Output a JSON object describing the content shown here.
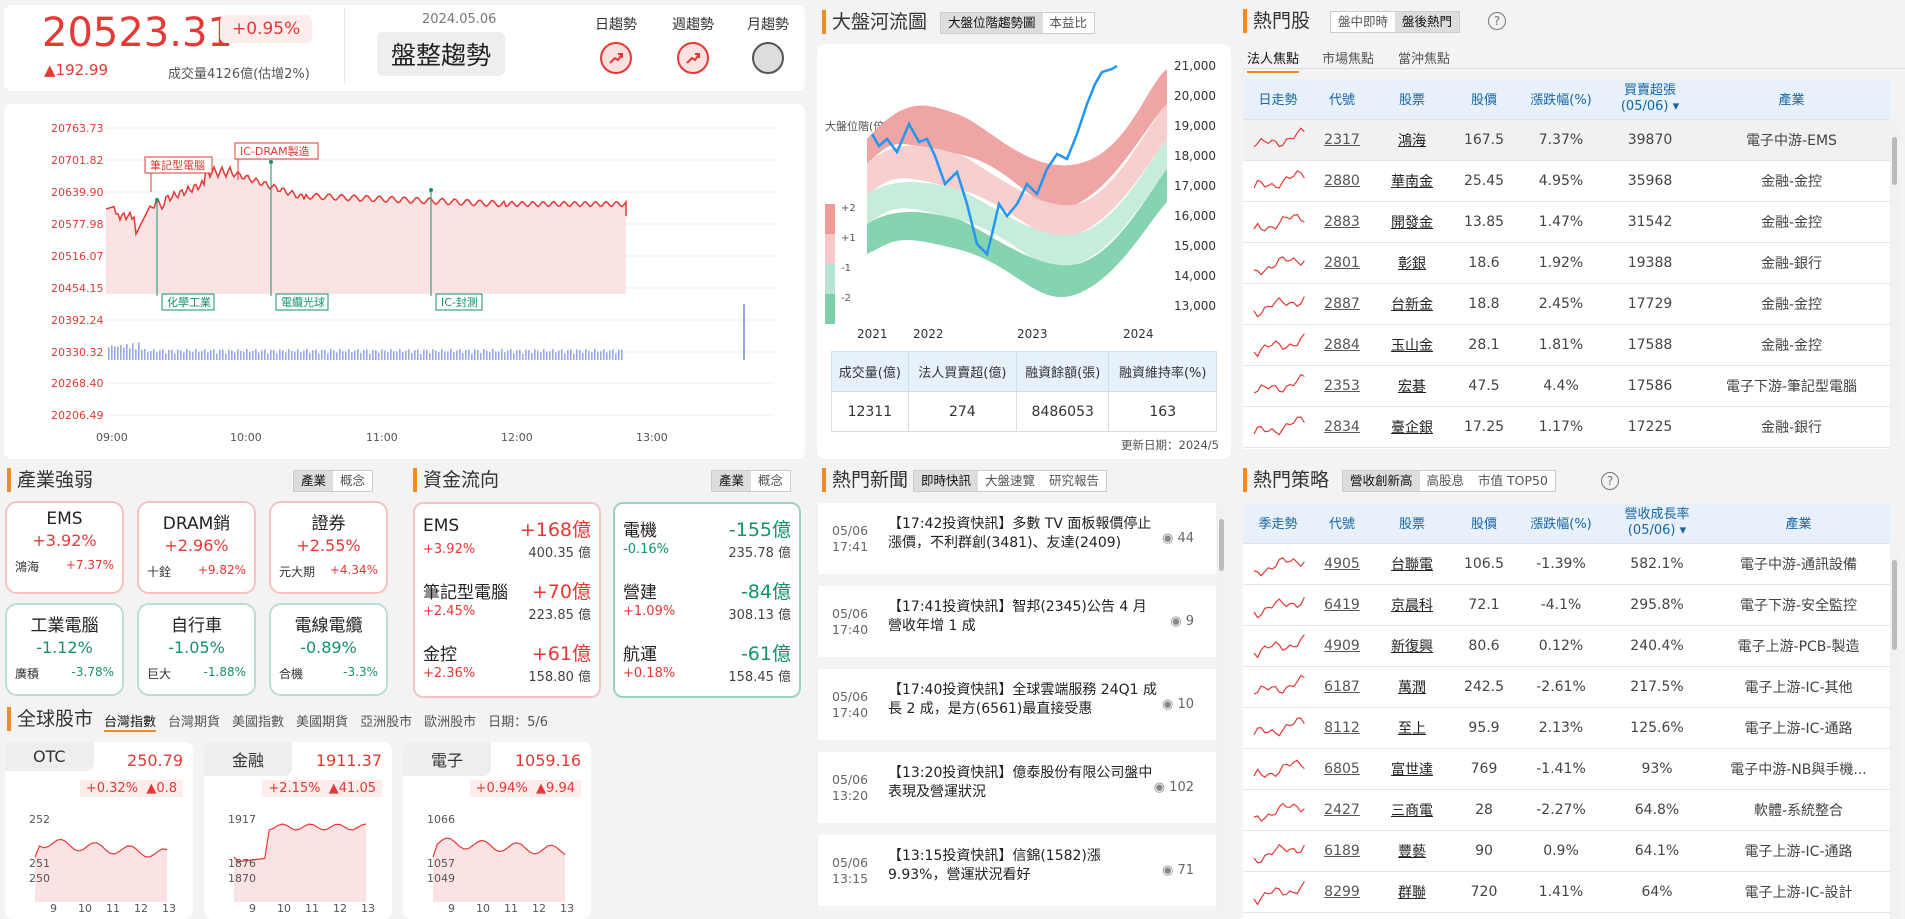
{
  "quote": {
    "last": "20523.31",
    "pct": "+0.95%",
    "chg": "▲192.99",
    "vol": "成交量4126億(估增2%)",
    "date": "2024.05.06",
    "trend": "盤整趨勢",
    "trends": [
      {
        "label": "日趨勢"
      },
      {
        "label": "週趨勢"
      },
      {
        "label": "月趨勢"
      }
    ]
  },
  "intraday": {
    "ylabels": [
      "20763.73",
      "20701.82",
      "20639.90",
      "20577.98",
      "20516.07",
      "20454.15",
      "20392.24",
      "20330.32"
    ],
    "vlabels": [
      "20268.40",
      "20206.49"
    ],
    "xlabels": [
      "09:00",
      "10:00",
      "11:00",
      "12:00",
      "13:00"
    ],
    "events_top": [
      "筆記型電腦",
      "IC-DRAM製造"
    ],
    "events_bottom": [
      "化學工業",
      "電纜光球",
      "IC-封測"
    ]
  },
  "river": {
    "title": "大盤河流圖",
    "tabs": [
      "大盤位階趨勢圖",
      "本益比"
    ],
    "ylabel": "大盤位階(倍)",
    "yticks": [
      "21,000",
      "20,000",
      "19,000",
      "18,000",
      "17,000",
      "16,000",
      "15,000",
      "14,000",
      "13,000"
    ],
    "xticks": [
      "2021",
      "2022",
      "2023",
      "2024"
    ],
    "bands": [
      "+2",
      "+1",
      "-1",
      "-2"
    ],
    "stats_head": [
      "成交量(億)",
      "法人買賣超(億)",
      "融資餘額(張)",
      "融資維持率(%)"
    ],
    "stats": [
      "12311",
      "274",
      "8486053",
      "163"
    ],
    "updated": "更新日期：2024/5"
  },
  "hot": {
    "title": "熱門股",
    "tabs": [
      "盤中即時",
      "盤後熱門"
    ],
    "subtabs": [
      "法人焦點",
      "市場焦點",
      "當沖焦點"
    ],
    "head": [
      "日走勢",
      "代號",
      "股票",
      "股價",
      "漲跌幅(%)",
      "買賣超張(05/06)",
      "產業"
    ],
    "rows": [
      {
        "code": "2317",
        "name": "鴻海",
        "price": "167.5",
        "pct": "7.37%",
        "net": "39870",
        "ind": "電子中游-EMS"
      },
      {
        "code": "2880",
        "name": "華南金",
        "price": "25.45",
        "pct": "4.95%",
        "net": "35968",
        "ind": "金融-金控"
      },
      {
        "code": "2883",
        "name": "開發金",
        "price": "13.85",
        "pct": "1.47%",
        "net": "31542",
        "ind": "金融-金控"
      },
      {
        "code": "2801",
        "name": "彰銀",
        "price": "18.6",
        "pct": "1.92%",
        "net": "19388",
        "ind": "金融-銀行"
      },
      {
        "code": "2887",
        "name": "台新金",
        "price": "18.8",
        "pct": "2.45%",
        "net": "17729",
        "ind": "金融-金控"
      },
      {
        "code": "2884",
        "name": "玉山金",
        "price": "28.1",
        "pct": "1.81%",
        "net": "17588",
        "ind": "金融-金控"
      },
      {
        "code": "2353",
        "name": "宏碁",
        "price": "47.5",
        "pct": "4.4%",
        "net": "17586",
        "ind": "電子下游-筆記型電腦"
      },
      {
        "code": "2834",
        "name": "臺企銀",
        "price": "17.25",
        "pct": "1.17%",
        "net": "17225",
        "ind": "金融-銀行"
      }
    ]
  },
  "industry": {
    "title": "產業強弱",
    "tabs": [
      "產業",
      "概念"
    ],
    "cards": [
      {
        "name": "EMS",
        "pct": "+3.92%",
        "stock": "鴻海",
        "spct": "+7.37%"
      },
      {
        "name": "DRAM銷",
        "pct": "+2.96%",
        "stock": "十銓",
        "spct": "+9.82%"
      },
      {
        "name": "證券",
        "pct": "+2.55%",
        "stock": "元大期",
        "spct": "+4.34%"
      },
      {
        "name": "工業電腦",
        "pct": "-1.12%",
        "stock": "廣積",
        "spct": "-3.78%"
      },
      {
        "name": "自行車",
        "pct": "-1.05%",
        "stock": "巨大",
        "spct": "-1.88%"
      },
      {
        "name": "電線電纜",
        "pct": "-0.89%",
        "stock": "合機",
        "spct": "-3.3%"
      }
    ]
  },
  "flow": {
    "title": "資金流向",
    "tabs": [
      "產業",
      "概念"
    ],
    "in": [
      {
        "name": "EMS",
        "amt": "+168億",
        "pct": "+3.92%",
        "vol": "400.35 億"
      },
      {
        "name": "筆記型電腦",
        "amt": "+70億",
        "pct": "+2.45%",
        "vol": "223.85 億"
      },
      {
        "name": "金控",
        "amt": "+61億",
        "pct": "+2.36%",
        "vol": "158.80 億"
      }
    ],
    "out": [
      {
        "name": "電機",
        "amt": "-155億",
        "pct": "-0.16%",
        "vol": "235.78 億"
      },
      {
        "name": "營建",
        "amt": "-84億",
        "pct": "+1.09%",
        "vol": "308.13 億"
      },
      {
        "name": "航運",
        "amt": "-61億",
        "pct": "+0.18%",
        "vol": "158.45 億"
      }
    ]
  },
  "news": {
    "title": "熱門新聞",
    "tabs": [
      "即時快訊",
      "大盤速覽",
      "研究報告"
    ],
    "items": [
      {
        "date": "05/06",
        "time": "17:41",
        "text": "【17:42投資快訊】多數 TV 面板報價停止漲價，不利群創(3481)、友達(2409)",
        "views": "44"
      },
      {
        "date": "05/06",
        "time": "17:40",
        "text": "【17:41投資快訊】智邦(2345)公告 4 月營收年增 1 成",
        "views": "9"
      },
      {
        "date": "05/06",
        "time": "17:40",
        "text": "【17:40投資快訊】全球雲端服務 24Q1 成長 2 成，是方(6561)最直接受惠",
        "views": "10"
      },
      {
        "date": "05/06",
        "time": "13:20",
        "text": "【13:20投資快訊】億泰股份有限公司盤中表現及營運狀況",
        "views": "102"
      },
      {
        "date": "05/06",
        "time": "13:15",
        "text": "【13:15投資快訊】信錦(1582)漲 9.93%，營運狀況看好",
        "views": "71"
      }
    ]
  },
  "strategy": {
    "title": "熱門策略",
    "tabs": [
      "營收創新高",
      "高股息",
      "市值 TOP50"
    ],
    "head": [
      "季走勢",
      "代號",
      "股票",
      "股價",
      "漲跌幅(%)",
      "營收成長率(05/06)",
      "產業"
    ],
    "rows": [
      {
        "code": "4905",
        "name": "台聯電",
        "price": "106.5",
        "pct": "-1.39%",
        "g": "582.1%",
        "ind": "電子中游-通訊設備"
      },
      {
        "code": "6419",
        "name": "京晨科",
        "price": "72.1",
        "pct": "-4.1%",
        "g": "295.8%",
        "ind": "電子下游-安全監控"
      },
      {
        "code": "4909",
        "name": "新復興",
        "price": "80.6",
        "pct": "0.12%",
        "g": "240.4%",
        "ind": "電子上游-PCB-製造"
      },
      {
        "code": "6187",
        "name": "萬潤",
        "price": "242.5",
        "pct": "-2.61%",
        "g": "217.5%",
        "ind": "電子上游-IC-其他"
      },
      {
        "code": "8112",
        "name": "至上",
        "price": "95.9",
        "pct": "2.13%",
        "g": "125.6%",
        "ind": "電子上游-IC-通路"
      },
      {
        "code": "6805",
        "name": "富世達",
        "price": "769",
        "pct": "-1.41%",
        "g": "93%",
        "ind": "電子中游-NB與手機..."
      },
      {
        "code": "2427",
        "name": "三商電",
        "price": "28",
        "pct": "-2.27%",
        "g": "64.8%",
        "ind": "軟體-系統整合"
      },
      {
        "code": "6189",
        "name": "豐藝",
        "price": "90",
        "pct": "0.9%",
        "g": "64.1%",
        "ind": "電子上游-IC-通路"
      },
      {
        "code": "8299",
        "name": "群聯",
        "price": "720",
        "pct": "1.41%",
        "g": "64%",
        "ind": "電子上游-IC-設計"
      }
    ]
  },
  "global": {
    "title": "全球股市",
    "tabs": [
      "台灣指數",
      "台灣期貨",
      "美國指數",
      "美國期貨",
      "亞洲股市",
      "歐洲股市"
    ],
    "date": "日期：5/6",
    "cards": [
      {
        "name": "OTC",
        "val": "250.79",
        "pct": "+0.32%",
        "chg": "▲0.8",
        "yt": "252",
        "ym": "251",
        "yb": "250"
      },
      {
        "name": "金融",
        "val": "1911.37",
        "pct": "+2.15%",
        "chg": "▲41.05",
        "yt": "1917",
        "ym": "1876",
        "yb": "1870"
      },
      {
        "name": "電子",
        "val": "1059.16",
        "pct": "+0.94%",
        "chg": "▲9.94",
        "yt": "1066",
        "ym": "1057",
        "yb": "1049"
      }
    ],
    "xt": [
      "9",
      "10",
      "11",
      "12",
      "13"
    ]
  }
}
